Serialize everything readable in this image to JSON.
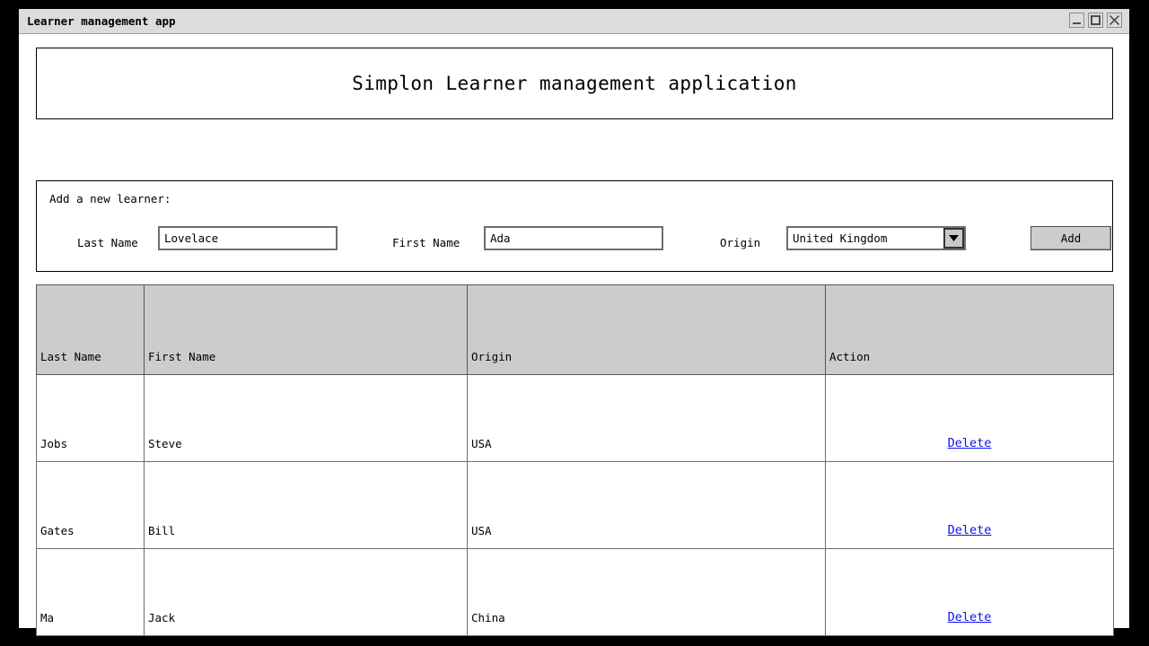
{
  "window": {
    "title": "Learner management app",
    "controls": [
      {
        "name": "minimize",
        "glyph": "minimize-icon"
      },
      {
        "name": "maximize",
        "glyph": "maximize-icon"
      },
      {
        "name": "close",
        "glyph": "close-icon"
      }
    ]
  },
  "header": {
    "heading": "Simplon Learner management application"
  },
  "form": {
    "legend": "Add a new learner:",
    "last_name": {
      "label": "Last Name",
      "value": "Lovelace",
      "placeholder": ""
    },
    "first_name": {
      "label": "First Name",
      "value": "Ada",
      "placeholder": ""
    },
    "origin": {
      "label": "Origin",
      "value": "United Kingdom",
      "arrow_icon": "chevron-down-icon"
    },
    "add_button": "Add"
  },
  "table": {
    "columns": [
      "Last Name",
      "First Name",
      "Origin",
      "Action"
    ],
    "rows": [
      {
        "last_name": "Jobs",
        "first_name": "Steve",
        "origin": "USA",
        "action": "Delete"
      },
      {
        "last_name": "Gates",
        "first_name": "Bill",
        "origin": "USA",
        "action": "Delete"
      },
      {
        "last_name": "Ma",
        "first_name": "Jack",
        "origin": "China",
        "action": "Delete"
      }
    ]
  },
  "colors": {
    "titlebar": "#dcdcdc",
    "header_row": "#cccccc",
    "link": "#1010f0",
    "button": "#cdcdcd",
    "desktop": "#000000"
  }
}
